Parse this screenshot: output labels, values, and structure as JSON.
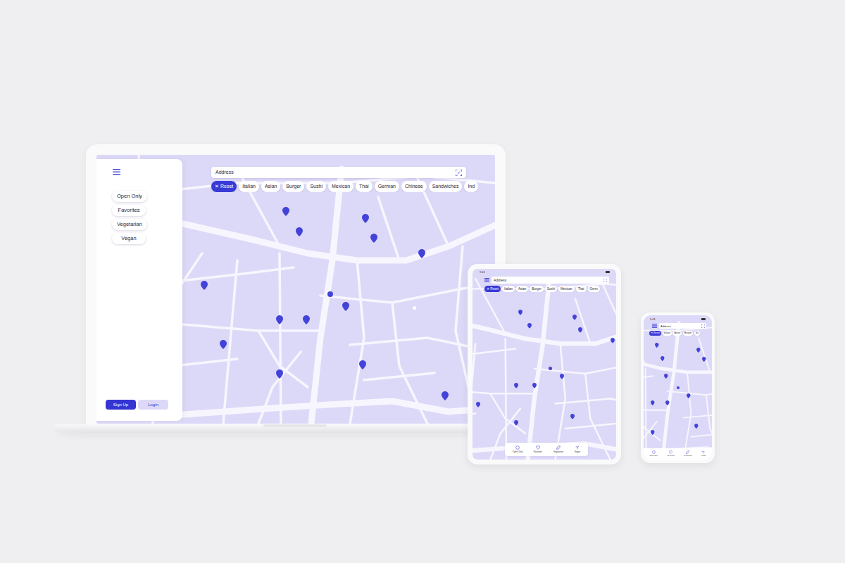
{
  "laptop": {
    "search": {
      "placeholder": "Address"
    },
    "chips": [
      {
        "label": "✕ Reset",
        "selected": true
      },
      {
        "label": "Italian",
        "selected": false
      },
      {
        "label": "Asian",
        "selected": false
      },
      {
        "label": "Burger",
        "selected": false
      },
      {
        "label": "Sushi",
        "selected": false
      },
      {
        "label": "Mexican",
        "selected": false
      },
      {
        "label": "Thai",
        "selected": false
      },
      {
        "label": "German",
        "selected": false
      },
      {
        "label": "Chinese",
        "selected": false
      },
      {
        "label": "Sandwiches",
        "selected": false
      },
      {
        "label": "Ind",
        "selected": false
      }
    ],
    "sidebar": {
      "filters": [
        "Open Only",
        "Favorites",
        "Vegetarian",
        "Vegan"
      ]
    },
    "buttons": [
      {
        "label": "Sign Up",
        "kind": "primary"
      },
      {
        "label": "Login",
        "kind": "secondary"
      }
    ]
  },
  "tablet": {
    "status_time": "9:41",
    "search": {
      "placeholder": "Address"
    },
    "chips": [
      {
        "label": "✕ Reset",
        "selected": true
      },
      {
        "label": "Italian",
        "selected": false
      },
      {
        "label": "Asian",
        "selected": false
      },
      {
        "label": "Burger",
        "selected": false
      },
      {
        "label": "Sushi",
        "selected": false
      },
      {
        "label": "Mexican",
        "selected": false
      },
      {
        "label": "Thai",
        "selected": false
      },
      {
        "label": "Germ",
        "selected": false
      }
    ],
    "nav": [
      "Open Only",
      "Favorites",
      "Vegetarian",
      "Vegan"
    ]
  },
  "phone": {
    "status_time": "9:41",
    "search": {
      "placeholder": "Address"
    },
    "chips": [
      {
        "label": "✕ Reset",
        "selected": true
      },
      {
        "label": "Italian",
        "selected": false
      },
      {
        "label": "Asian",
        "selected": false
      },
      {
        "label": "Burger",
        "selected": false
      },
      {
        "label": "Su",
        "selected": false
      }
    ],
    "nav": [
      "Open Only",
      "Favorites",
      "Vegetarian",
      "Vegan"
    ]
  }
}
